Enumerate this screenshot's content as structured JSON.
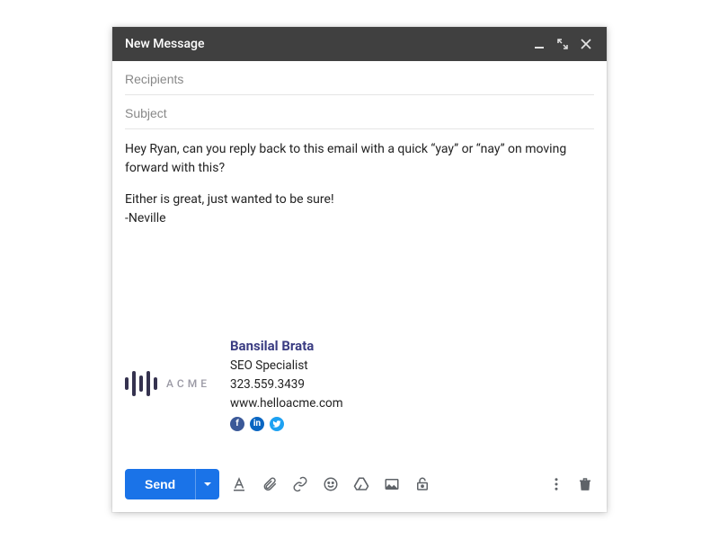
{
  "header": {
    "title": "New Message"
  },
  "fields": {
    "recipients_placeholder": "Recipients",
    "recipients_value": "",
    "subject_placeholder": "Subject",
    "subject_value": ""
  },
  "body": {
    "line1": "Hey Ryan, can you reply back to this email with a quick “yay” or “nay” on moving forward with this?",
    "line2": "Either is great, just wanted to be sure!",
    "line3": "-Neville"
  },
  "signature": {
    "logo_text": "ACME",
    "name": "Bansilal Brata",
    "role": "SEO Specialist",
    "phone": "323.559.3439",
    "url": "www.helloacme.com"
  },
  "toolbar": {
    "send_label": "Send"
  }
}
